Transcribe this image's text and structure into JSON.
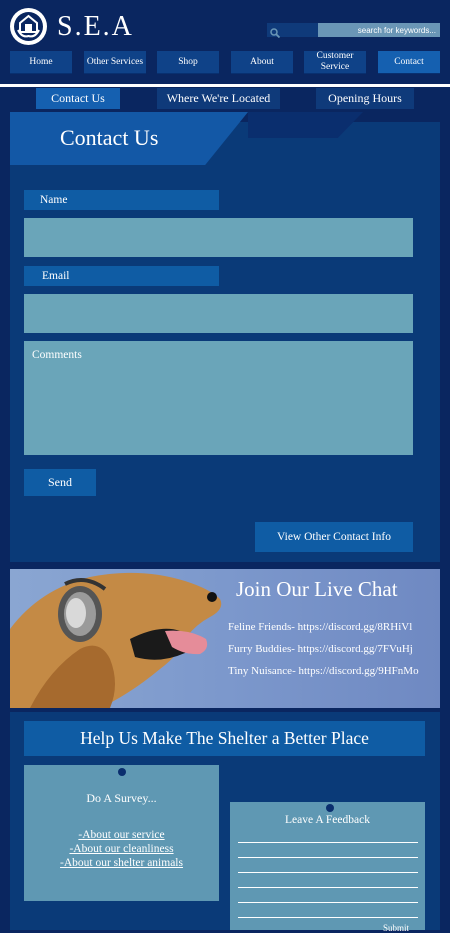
{
  "brand": {
    "name": "S.E.A"
  },
  "search": {
    "placeholder": "search for keywords..."
  },
  "nav": {
    "items": [
      "Home",
      "Other Services",
      "Shop",
      "About",
      "Customer Service",
      "Contact"
    ]
  },
  "tabs": [
    "Contact Us",
    "Where We're Located",
    "Opening Hours"
  ],
  "contact": {
    "title": "Contact Us",
    "name_label": "Name",
    "email_label": "Email",
    "comments_placeholder": "Comments",
    "send_label": "Send",
    "other_label": "View Other Contact Info"
  },
  "chat": {
    "title": "Join Our Live Chat",
    "links": [
      {
        "label": "Feline Friends- ",
        "url": "https://discord.gg/8RHiVl"
      },
      {
        "label": "Furry Buddies- ",
        "url": "https://discord.gg/7FVuHj"
      },
      {
        "label": "Tiny Nuisance- ",
        "url": "https://discord.gg/9HFnMo"
      }
    ]
  },
  "help": {
    "title": "Help Us Make The Shelter a Better Place",
    "survey_title": "Do A Survey...",
    "survey_links": [
      "-About our service",
      "-About our cleanliness",
      "-About our shelter animals"
    ],
    "feedback_title": "Leave A Feedback",
    "submit_label": "Submit"
  },
  "colors": {
    "background": "#0a2660",
    "accent": "#0f5ca4",
    "field": "#6aa5b9"
  }
}
